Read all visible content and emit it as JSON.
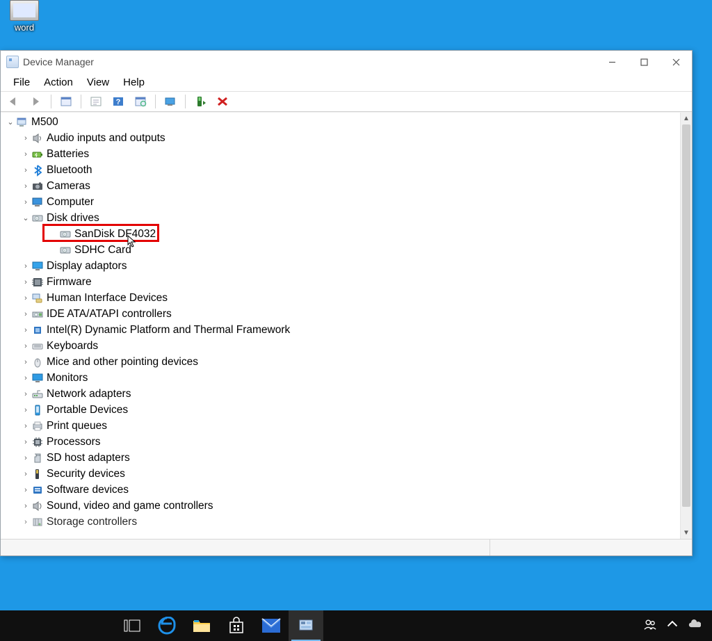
{
  "desktop": {
    "icon_label": "word"
  },
  "window": {
    "title": "Device Manager",
    "menus": [
      "File",
      "Action",
      "View",
      "Help"
    ],
    "toolbar": {
      "back": "back-icon",
      "forward": "forward-icon",
      "props": "properties-icon",
      "refresh": "refresh-icon",
      "help": "help-icon",
      "scan": "scan-hardware-icon",
      "screen": "show-hidden-icon",
      "enable": "enable-device-icon",
      "uninstall": "uninstall-icon"
    },
    "root": "M500",
    "categories": [
      {
        "label": "Audio inputs and outputs",
        "icon": "speaker-icon"
      },
      {
        "label": "Batteries",
        "icon": "battery-icon"
      },
      {
        "label": "Bluetooth",
        "icon": "bluetooth-icon"
      },
      {
        "label": "Cameras",
        "icon": "camera-icon"
      },
      {
        "label": "Computer",
        "icon": "computer-icon"
      },
      {
        "label": "Disk drives",
        "icon": "disk-icon",
        "expanded": true,
        "children": [
          {
            "label": "SanDisk DF4032",
            "icon": "disk-icon",
            "highlight": true
          },
          {
            "label": "SDHC Card",
            "icon": "disk-icon"
          }
        ]
      },
      {
        "label": "Display adaptors",
        "icon": "display-icon"
      },
      {
        "label": "Firmware",
        "icon": "firmware-icon"
      },
      {
        "label": "Human Interface Devices",
        "icon": "hid-icon"
      },
      {
        "label": "IDE ATA/ATAPI controllers",
        "icon": "ide-icon"
      },
      {
        "label": "Intel(R) Dynamic Platform and Thermal Framework",
        "icon": "chip-icon"
      },
      {
        "label": "Keyboards",
        "icon": "keyboard-icon"
      },
      {
        "label": "Mice and other pointing devices",
        "icon": "mouse-icon"
      },
      {
        "label": "Monitors",
        "icon": "monitor-icon"
      },
      {
        "label": "Network adapters",
        "icon": "network-icon"
      },
      {
        "label": "Portable Devices",
        "icon": "portable-icon"
      },
      {
        "label": "Print queues",
        "icon": "printer-icon"
      },
      {
        "label": "Processors",
        "icon": "cpu-icon"
      },
      {
        "label": "SD host adapters",
        "icon": "sd-icon"
      },
      {
        "label": "Security devices",
        "icon": "security-icon"
      },
      {
        "label": "Software devices",
        "icon": "software-icon"
      },
      {
        "label": "Sound, video and game controllers",
        "icon": "sound-icon"
      },
      {
        "label": "Storage controllers",
        "icon": "storage-icon",
        "truncated": true
      }
    ]
  },
  "taskbar": {
    "items": [
      "taskview-icon",
      "edge-icon",
      "explorer-icon",
      "store-icon",
      "mail-icon",
      "devmgr-icon"
    ],
    "tray": [
      "people-icon",
      "chevron-up-icon",
      "onedrive-icon"
    ]
  },
  "colors": {
    "desktop_bg": "#1e98e6",
    "highlight_border": "#e30000",
    "taskbar_bg": "#101010"
  }
}
